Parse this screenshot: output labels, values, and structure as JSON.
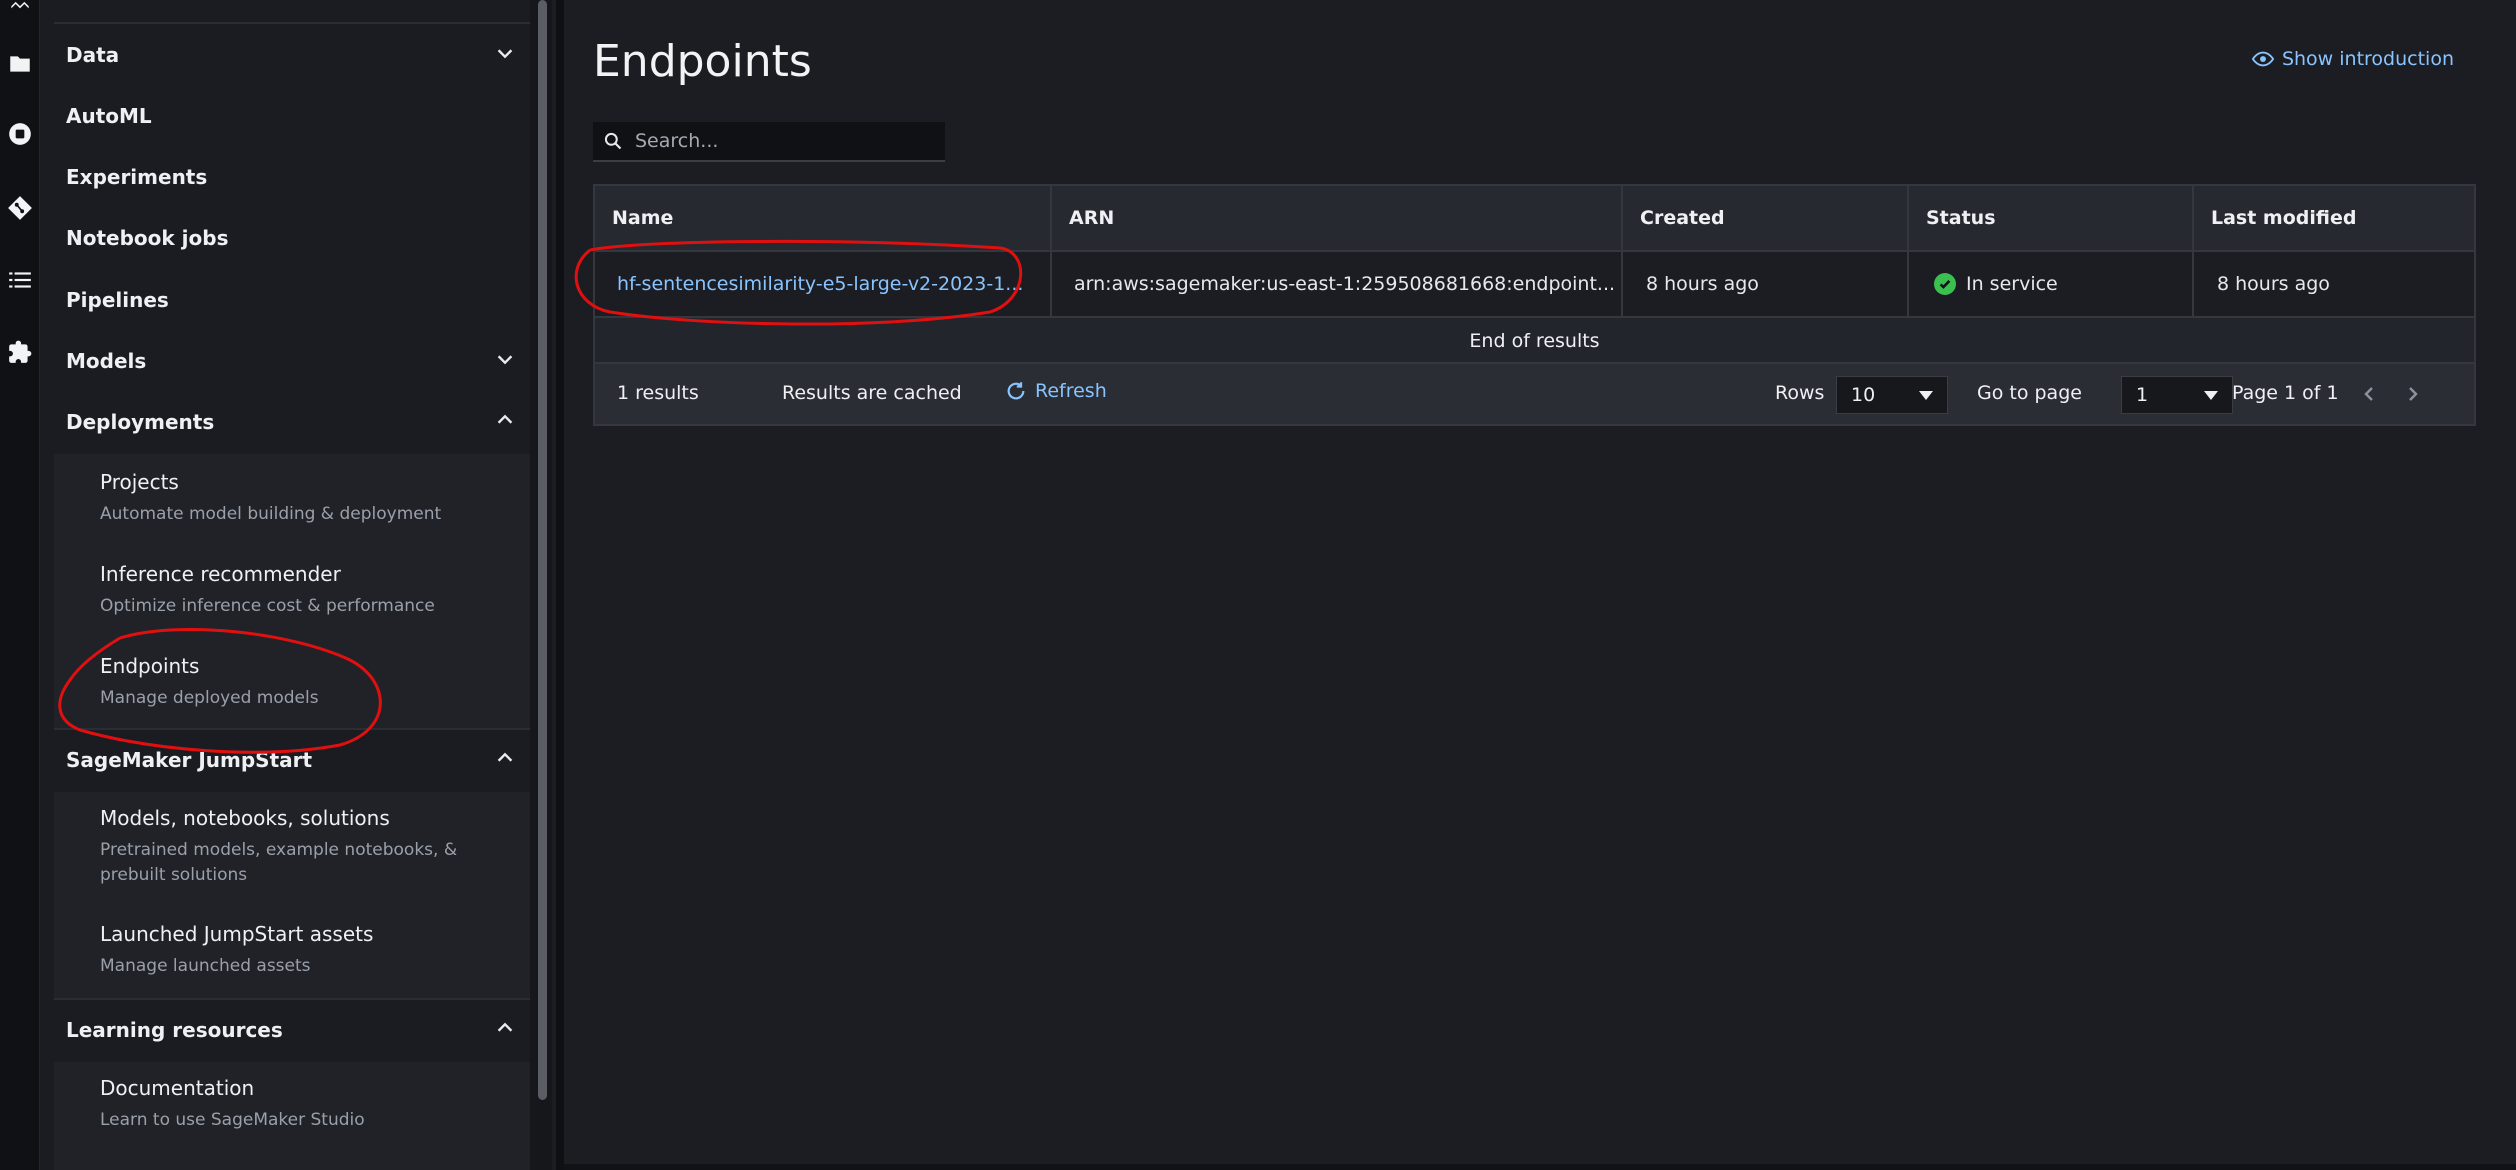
{
  "sidebar": {
    "nav": [
      {
        "label": "Data",
        "chevron": "down"
      },
      {
        "label": "AutoML"
      },
      {
        "label": "Experiments"
      },
      {
        "label": "Notebook jobs"
      },
      {
        "label": "Pipelines"
      },
      {
        "label": "Models",
        "chevron": "down"
      },
      {
        "label": "Deployments",
        "chevron": "up"
      }
    ],
    "deployments": [
      {
        "title": "Projects",
        "desc": "Automate model building & deployment"
      },
      {
        "title": "Inference recommender",
        "desc": "Optimize inference cost & performance"
      },
      {
        "title": "Endpoints",
        "desc": "Manage deployed models"
      }
    ],
    "jumpstart": {
      "label": "SageMaker JumpStart",
      "items": [
        {
          "title": "Models, notebooks, solutions",
          "desc": "Pretrained models, example notebooks, & prebuilt solutions"
        },
        {
          "title": "Launched JumpStart assets",
          "desc": "Manage launched assets"
        }
      ]
    },
    "learning": {
      "label": "Learning resources",
      "items": [
        {
          "title": "Documentation",
          "desc": "Learn to use SageMaker Studio"
        }
      ]
    }
  },
  "main": {
    "title": "Endpoints",
    "show_intro": "Show introduction",
    "search_placeholder": "Search...",
    "columns": [
      "Name",
      "ARN",
      "Created",
      "Status",
      "Last modified"
    ],
    "rows": [
      {
        "name": "hf-sentencesimilarity-e5-large-v2-2023-1...",
        "arn": "arn:aws:sagemaker:us-east-1:259508681668:endpoint...",
        "created": "8 hours ago",
        "status": "In service",
        "last_modified": "8 hours ago"
      }
    ],
    "end_of_results": "End of results",
    "footer": {
      "count": "1 results",
      "cached": "Results are cached",
      "refresh": "Refresh",
      "rows_label": "Rows",
      "rows_value": "10",
      "goto_label": "Go to page",
      "goto_value": "1",
      "page_info": "Page 1 of 1"
    }
  },
  "colors": {
    "accent_link": "#89c4ff",
    "status_ok": "#3bbf4e",
    "annotation": "#e01010"
  }
}
